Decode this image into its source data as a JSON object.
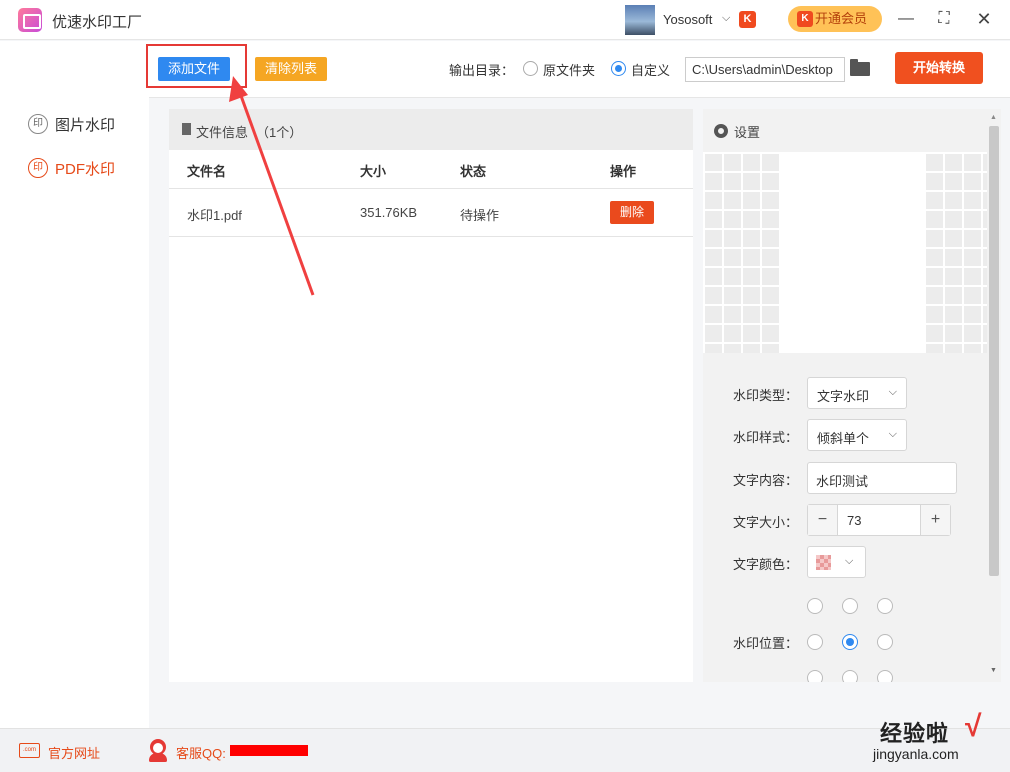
{
  "app": {
    "title": "优速水印工厂"
  },
  "user": {
    "name": "Yososoft",
    "badge": "K",
    "vip_label": "开通会员"
  },
  "window_controls": {
    "minimize": "—",
    "maximize": "⛶",
    "close": "✕"
  },
  "sidebar": {
    "items": [
      {
        "label": "图片水印",
        "seal": "印"
      },
      {
        "label": "PDF水印",
        "seal": "印"
      }
    ]
  },
  "toolbar": {
    "add_file": "添加文件",
    "clear_list": "清除列表",
    "output_label": "输出目录：",
    "radio_original": "原文件夹",
    "radio_custom": "自定义",
    "output_path": "C:\\Users\\admin\\Desktop",
    "start": "开始转换"
  },
  "file_panel": {
    "title": "文件信息",
    "count": "（1个）",
    "columns": [
      "文件名",
      "大小",
      "状态",
      "操作"
    ],
    "rows": [
      {
        "name": "水印1.pdf",
        "size": "351.76KB",
        "status": "待操作",
        "action": "删除"
      }
    ]
  },
  "settings": {
    "title": "设置",
    "watermark_type_label": "水印类型：",
    "watermark_type": "文字水印",
    "watermark_style_label": "水印样式：",
    "watermark_style": "倾斜单个",
    "text_content_label": "文字内容：",
    "text_content": "水印测试",
    "font_size_label": "文字大小：",
    "font_size": "73",
    "font_color_label": "文字颜色：",
    "position_label": "水印位置：",
    "position_selected": "middle-center"
  },
  "footer": {
    "website_label": "官方网址",
    "website_icon_text": ".com",
    "support_label": "客服QQ:"
  },
  "watermark_overlay": {
    "brand": "经验啦",
    "check": "√",
    "url": "jingyanla.com"
  },
  "colors": {
    "accent_blue": "#2f89f0",
    "accent_orange": "#f5a623",
    "danger_red": "#f0501f",
    "highlight": "#e53935"
  }
}
